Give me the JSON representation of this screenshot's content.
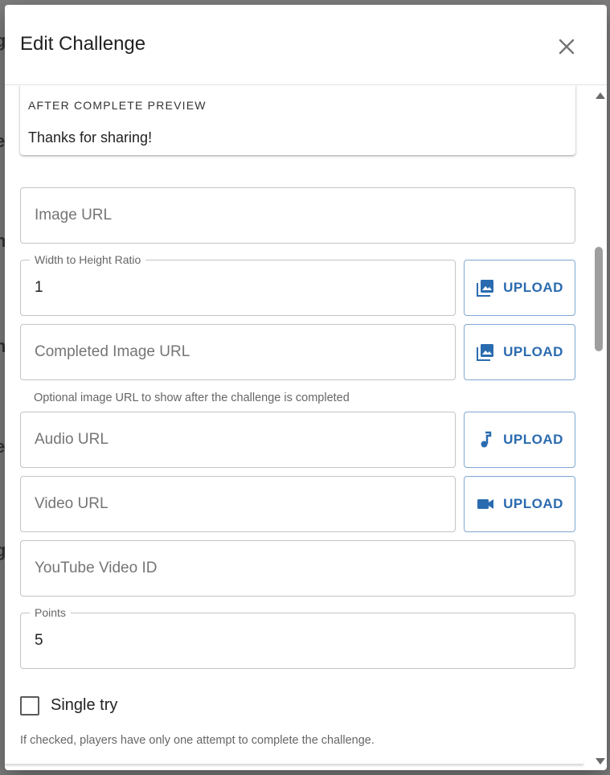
{
  "dialog": {
    "title": "Edit Challenge"
  },
  "preview": {
    "heading": "AFTER COMPLETE PREVIEW",
    "text": "Thanks for sharing!"
  },
  "fields": {
    "image_url": {
      "placeholder": "Image URL"
    },
    "ratio": {
      "label": "Width to Height Ratio",
      "value": "1"
    },
    "completed_image_url": {
      "placeholder": "Completed Image URL",
      "helper": "Optional image URL to show after the challenge is completed"
    },
    "audio_url": {
      "placeholder": "Audio URL"
    },
    "video_url": {
      "placeholder": "Video URL"
    },
    "youtube_id": {
      "placeholder": "YouTube Video ID"
    },
    "points": {
      "label": "Points",
      "value": "5"
    }
  },
  "upload_label": "UPLOAD",
  "single_try": {
    "label": "Single try",
    "checked": false,
    "helper": "If checked, players have only one attempt to complete the challenge."
  },
  "colors": {
    "accent": "#2a6bb0",
    "upload_border": "#7fa8d2",
    "overlay": "#7d7d7d"
  },
  "icons": {
    "close": "close-icon",
    "image": "image-icon",
    "audio": "music-note-icon",
    "video": "videocam-icon"
  }
}
